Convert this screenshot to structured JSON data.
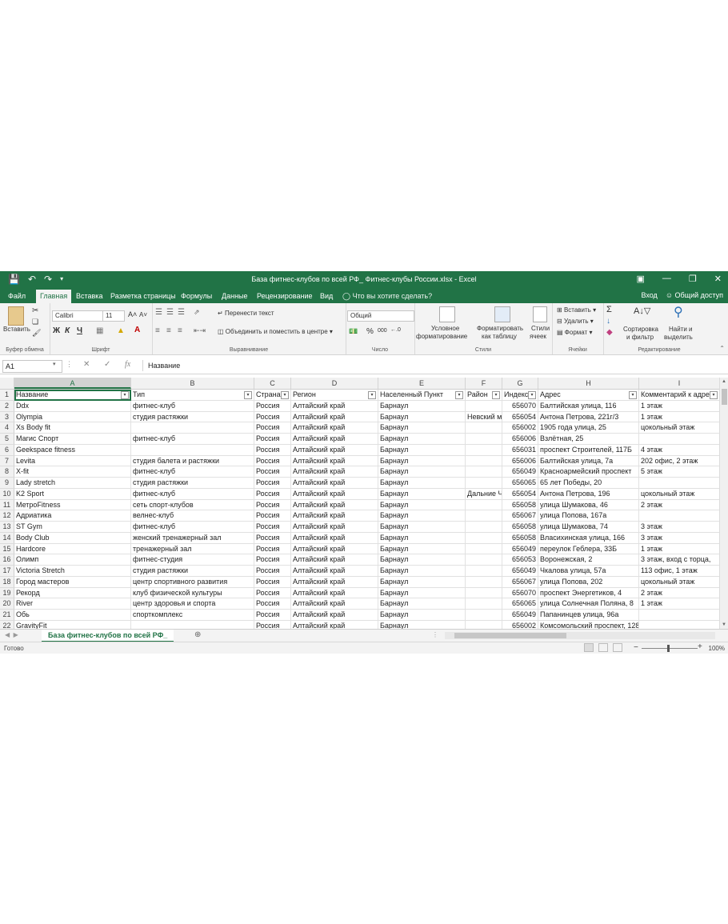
{
  "window": {
    "title": "База фитнес-клубов по всей РФ_ Фитнес-клубы России.xlsx - Excel"
  },
  "ribbon_tabs": [
    "Файл",
    "Главная",
    "Вставка",
    "Разметка страницы",
    "Формулы",
    "Данные",
    "Рецензирование",
    "Вид"
  ],
  "active_tab": "Главная",
  "tell_me": "Что вы хотите сделать?",
  "account": {
    "signin": "Вход",
    "share": "Общий доступ"
  },
  "ribbon": {
    "clipboard": {
      "paste": "Вставить",
      "label": "Буфер обмена"
    },
    "font": {
      "name": "Calibri",
      "size": "11",
      "bold": "Ж",
      "italic": "К",
      "underline": "Ч",
      "label": "Шрифт"
    },
    "alignment": {
      "wrap": "Перенести текст",
      "merge": "Объединить и поместить в центре",
      "label": "Выравнивание"
    },
    "number": {
      "format": "Общий",
      "label": "Число"
    },
    "styles": {
      "conditional1": "Условное",
      "conditional2": "форматирование",
      "format_table1": "Форматировать",
      "format_table2": "как таблицу",
      "cell_styles1": "Стили",
      "cell_styles2": "ячеек",
      "label": "Стили"
    },
    "cells": {
      "insert": "Вставить",
      "delete": "Удалить",
      "format": "Формат",
      "label": "Ячейки"
    },
    "editing": {
      "sort1": "Сортировка",
      "sort2": "и фильтр",
      "find1": "Найти и",
      "find2": "выделить",
      "label": "Редактирование"
    }
  },
  "formula_bar": {
    "cell_ref": "A1",
    "fx": "fx",
    "value": "Название"
  },
  "columns": [
    "A",
    "B",
    "C",
    "D",
    "E",
    "F",
    "G",
    "H",
    "I"
  ],
  "headers": [
    "Название",
    "Тип",
    "Страна",
    "Регион",
    "Населенный Пункт",
    "Район",
    "Индекс",
    "Адрес",
    "Комментарий к адре"
  ],
  "rows": [
    [
      "Ddx",
      "фитнес-клуб",
      "Россия",
      "Алтайский край",
      "Барнаул",
      "",
      "656070",
      "Балтийская улица, 116",
      "1 этаж"
    ],
    [
      "Olympia",
      "студия растяжки",
      "Россия",
      "Алтайский край",
      "Барнаул",
      "Невский м",
      "656054",
      "Антона Петрова, 221г/3",
      "1 этаж"
    ],
    [
      "Xs Body fit",
      "",
      "Россия",
      "Алтайский край",
      "Барнаул",
      "",
      "656002",
      "1905 года улица, 25",
      "цокольный этаж"
    ],
    [
      "Магис Спорт",
      "фитнес-клуб",
      "Россия",
      "Алтайский край",
      "Барнаул",
      "",
      "656006",
      "Взлётная, 25",
      ""
    ],
    [
      "Geekspace fitness",
      "",
      "Россия",
      "Алтайский край",
      "Барнаул",
      "",
      "656031",
      "проспект Строителей, 117Б",
      "4 этаж"
    ],
    [
      "Levita",
      "студия балета и растяжки",
      "Россия",
      "Алтайский край",
      "Барнаул",
      "",
      "656006",
      "Балтийская улица, 7а",
      "202 офис, 2 этаж"
    ],
    [
      "X-fit",
      "фитнес-клуб",
      "Россия",
      "Алтайский край",
      "Барнаул",
      "",
      "656049",
      "Красноармейский проспект",
      "5 этаж"
    ],
    [
      "Lady stretch",
      "студия растяжки",
      "Россия",
      "Алтайский край",
      "Барнаул",
      "",
      "656065",
      "65 лет Победы, 20",
      ""
    ],
    [
      "K2 Sport",
      "фитнес-клуб",
      "Россия",
      "Алтайский край",
      "Барнаул",
      "Дальние Ч",
      "656054",
      "Антона Петрова, 196",
      "цокольный этаж"
    ],
    [
      "МетроFitness",
      "сеть спорт-клубов",
      "Россия",
      "Алтайский край",
      "Барнаул",
      "",
      "656058",
      "улица Шумакова, 46",
      "2 этаж"
    ],
    [
      "Адриатика",
      "велнес-клуб",
      "Россия",
      "Алтайский край",
      "Барнаул",
      "",
      "656067",
      "улица Попова, 167а",
      ""
    ],
    [
      "ST Gym",
      "фитнес-клуб",
      "Россия",
      "Алтайский край",
      "Барнаул",
      "",
      "656058",
      "улица Шумакова, 74",
      "3 этаж"
    ],
    [
      "Body Club",
      "женский тренажерный зал",
      "Россия",
      "Алтайский край",
      "Барнаул",
      "",
      "656058",
      "Власихинская улица, 166",
      "3 этаж"
    ],
    [
      "Hardcore",
      "тренажерный зал",
      "Россия",
      "Алтайский край",
      "Барнаул",
      "",
      "656049",
      "переулок Геблера, 33Б",
      "1 этаж"
    ],
    [
      "Олимп",
      "фитнес-студия",
      "Россия",
      "Алтайский край",
      "Барнаул",
      "",
      "656053",
      "Воронежская, 2",
      "3 этаж, вход с торца,"
    ],
    [
      "Victoria Stretch",
      "студия растяжки",
      "Россия",
      "Алтайский край",
      "Барнаул",
      "",
      "656049",
      "Чкалова улица, 57а",
      "113 офис, 1 этаж"
    ],
    [
      "Город мастеров",
      "центр спортивного развития",
      "Россия",
      "Алтайский край",
      "Барнаул",
      "",
      "656067",
      "улица Попова, 202",
      "цокольный этаж"
    ],
    [
      "Рекорд",
      "клуб физической культуры",
      "Россия",
      "Алтайский край",
      "Барнаул",
      "",
      "656070",
      "проспект Энергетиков, 4",
      "2 этаж"
    ],
    [
      "River",
      "центр здоровья и спорта",
      "Россия",
      "Алтайский край",
      "Барнаул",
      "",
      "656065",
      "улица Солнечная Поляна, 8",
      "1 этаж"
    ],
    [
      "Обь",
      "спорткомплекс",
      "Россия",
      "Алтайский край",
      "Барнаул",
      "",
      "656049",
      "Папанинцев улица, 96а",
      ""
    ],
    [
      "GravityFit",
      "",
      "Россия",
      "Алтайский край",
      "Барнаул",
      "",
      "656002",
      "Комсомольский проспект, 128а",
      ""
    ]
  ],
  "sheet_tab": "База фитнес-клубов по всей РФ_",
  "status": {
    "ready": "Готово",
    "zoom": "100%"
  }
}
